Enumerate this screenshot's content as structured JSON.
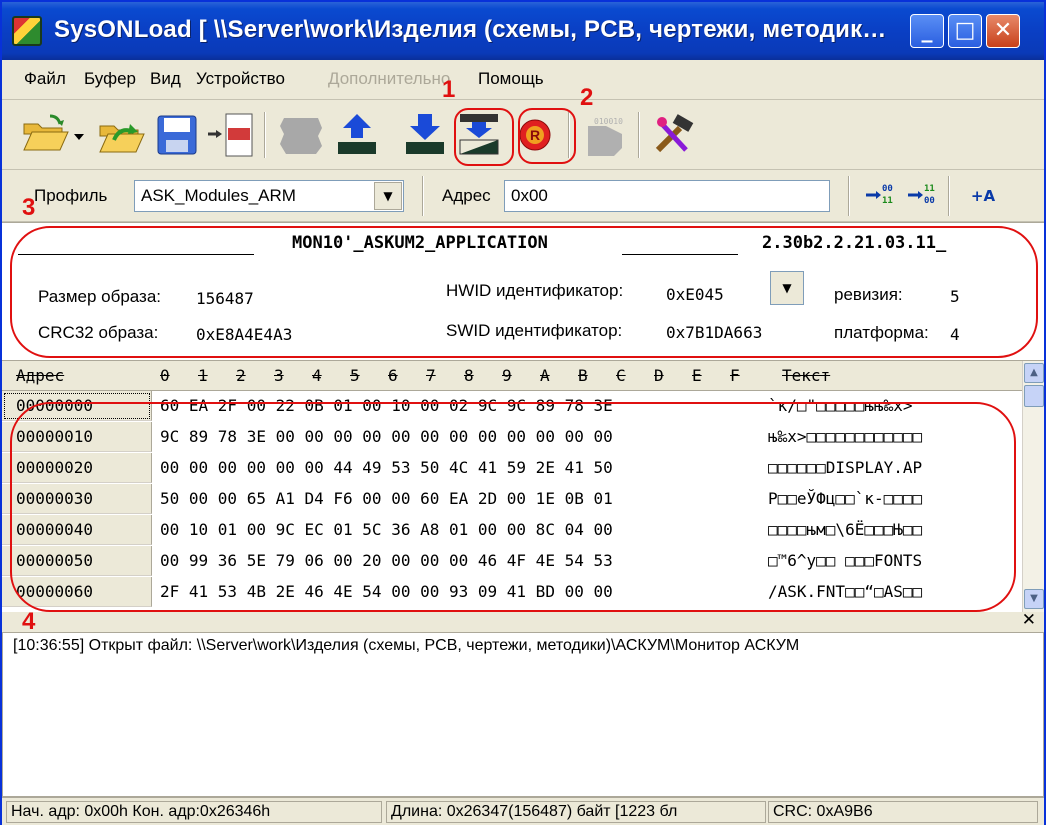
{
  "window": {
    "title": "SysONLoad   [ \\\\Server\\work\\Изделия (схемы, PCB, чертежи, методик…"
  },
  "menu": {
    "items": [
      "Файл",
      "Буфер",
      "Вид",
      "Устройство",
      "Дополнительно",
      "Помощь"
    ],
    "disabled_item": "Дополнительно"
  },
  "toolbar": {
    "icons": [
      "open-folder-icon",
      "dropdown-arrow-icon",
      "reload-icon",
      "save-icon",
      "hex-edit-icon",
      "chip-disabled-icon",
      "upload-icon",
      "download-icon",
      "program-icon",
      "reset-icon",
      "binary-disabled-icon",
      "tools-icon"
    ]
  },
  "profile": {
    "label": "Профиль",
    "value": "ASK_Modules_ARM",
    "address_label": "Адрес",
    "address_value": "0x00",
    "button_a_label": "+A"
  },
  "info": {
    "title": "MON10'_ASKUM2_APPLICATION",
    "version": "2.30b2.2.21.03.11_",
    "image_size_label": "Размер образа:",
    "image_size_value": "156487",
    "crc_label": "CRC32 образа:",
    "crc_value": "0xE8A4E4A3",
    "hwid_label": "HWID идентификатор:",
    "hwid_value": "0xE045",
    "swid_label": "SWID идентификатор:",
    "swid_value": "0x7B1DA663",
    "revision_label": "ревизия:",
    "revision_value": "5",
    "platform_label": "платформа:",
    "platform_value": "4"
  },
  "hex": {
    "header_address": "Адрес",
    "header_columns": [
      "0",
      "1",
      "2",
      "3",
      "4",
      "5",
      "6",
      "7",
      "8",
      "9",
      "A",
      "B",
      "C",
      "D",
      "E",
      "F"
    ],
    "header_text": "Текст",
    "rows": [
      {
        "addr": "00000000",
        "bytes": "60 EA 2F 00 22 0B 01 00 10 00 02 9C 9C 89 78 3E",
        "text": "`к/□\"□□□□□њњ‰x>"
      },
      {
        "addr": "00000010",
        "bytes": "9C 89 78 3E 00 00 00 00 00 00 00 00 00 00 00 00",
        "text": "њ‰x>□□□□□□□□□□□□"
      },
      {
        "addr": "00000020",
        "bytes": "00 00 00 00 00 00 44 49 53 50 4C 41 59 2E 41 50",
        "text": "□□□□□□DISPLAY.AP"
      },
      {
        "addr": "00000030",
        "bytes": "50 00 00 65 A1 D4 F6 00 00 60 EA 2D 00 1E 0B 01",
        "text": "P□□eЎФц□□`к-□□□□"
      },
      {
        "addr": "00000040",
        "bytes": "00 10 01 00 9C EC 01 5C 36 A8 01 00 00 8C 04 00",
        "text": "□□□□њм□\\6Ё□□□Њ□□"
      },
      {
        "addr": "00000050",
        "bytes": "00 99 36 5E 79 06 00 20 00 00 00 46 4F 4E 54 53",
        "text": "□™6^y□□ □□□FONTS"
      },
      {
        "addr": "00000060",
        "bytes": "2F 41 53 4B 2E 46 4E 54 00 00 93 09 41 BD 00 00",
        "text": "/ASK.FNT□□“□AS□□"
      }
    ]
  },
  "log": {
    "line": "[10:36:55]  Открыт файл: \\\\Server\\work\\Изделия (схемы, PCB, чертежи, методики)\\АСКУМ\\Монитор АСКУМ"
  },
  "status": {
    "start": "Нач. адр: 0x00h  Кон. адр:0x26346h",
    "length": "Длина: 0x26347(156487) байт [1223 бл",
    "crc": "CRC: 0xA9B6"
  },
  "annotations": {
    "labels": [
      "1",
      "2",
      "3",
      "4"
    ],
    "color": "#e01010"
  }
}
